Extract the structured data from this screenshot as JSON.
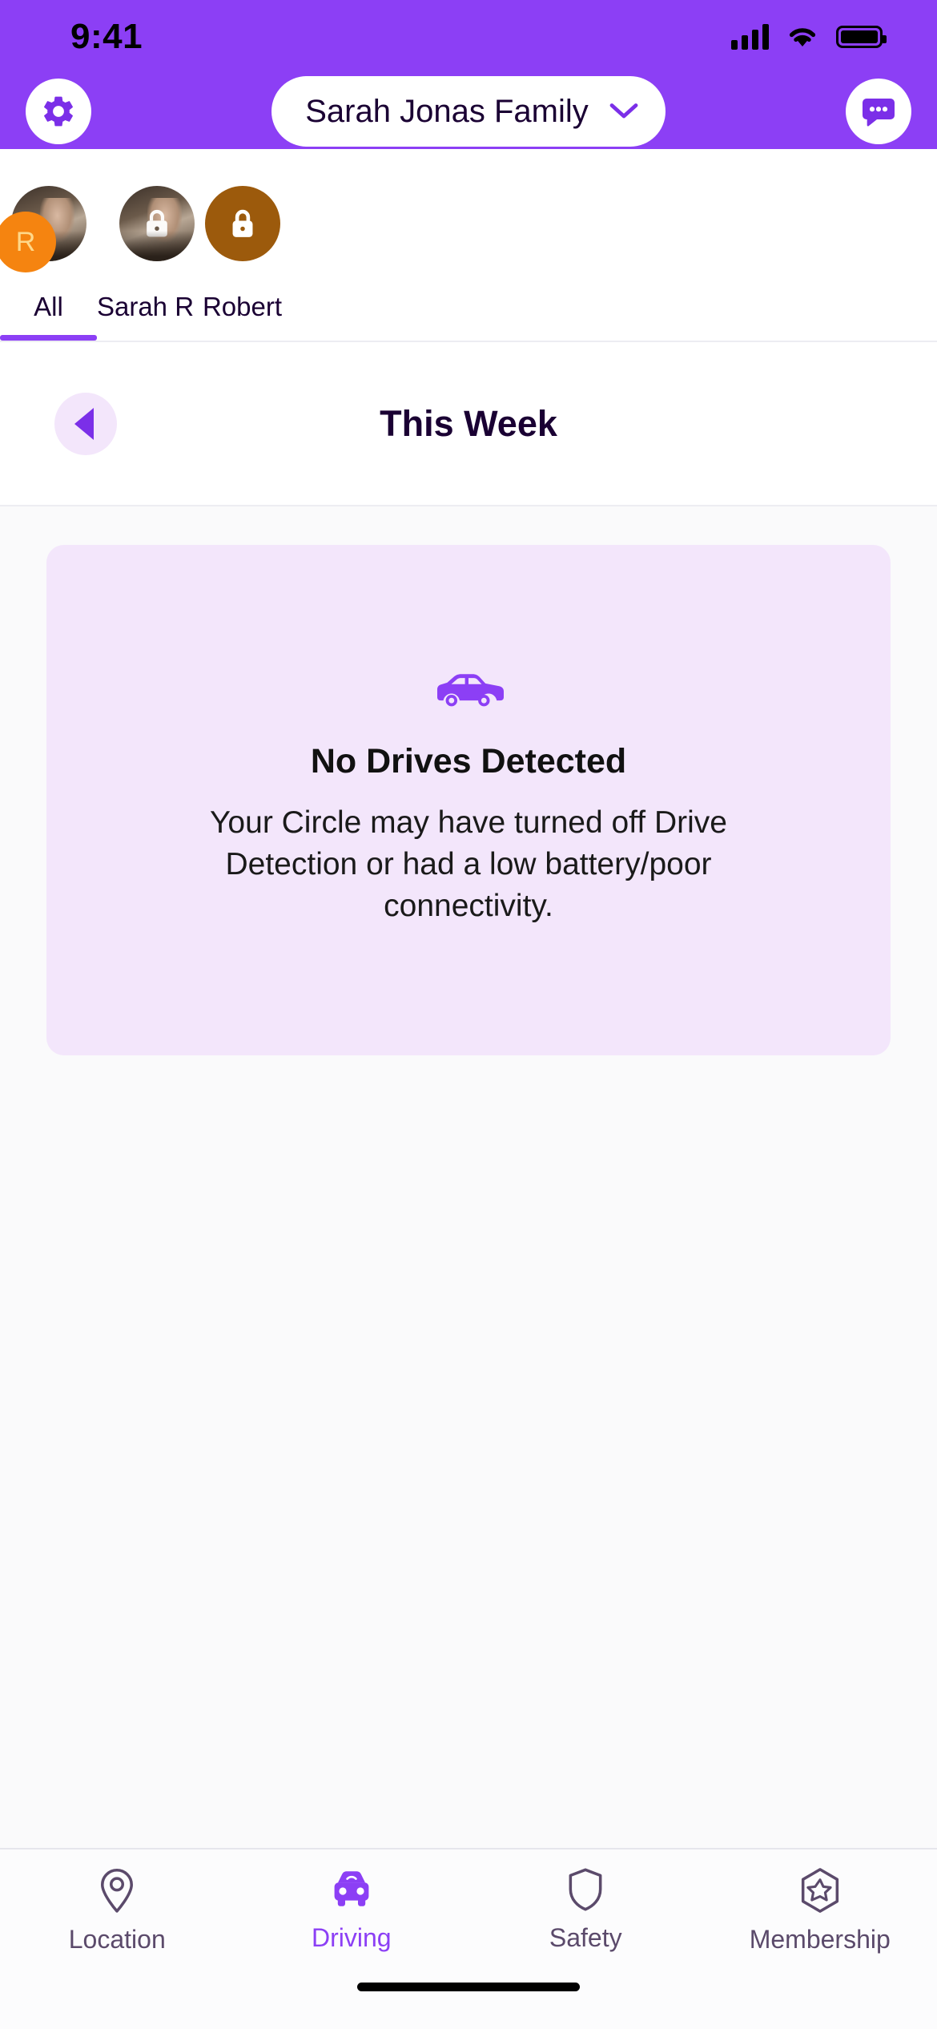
{
  "status_bar": {
    "time": "9:41",
    "signal_icon": "cellular-bars-icon",
    "wifi_icon": "wifi-icon",
    "battery_icon": "battery-full-icon"
  },
  "header": {
    "background_color": "#8C3FF5",
    "settings_icon": "gear-icon",
    "circle_name": "Sarah Jonas Family",
    "chevron_icon": "chevron-down-icon",
    "messages_icon": "chat-bubble-icon"
  },
  "member_tabs": {
    "active_index": 0,
    "items": [
      {
        "label": "All",
        "avatar_type": "stacked-photos",
        "badge_letter": "R",
        "badge_color": "#F58410",
        "active": true
      },
      {
        "label": "Sarah R",
        "avatar_type": "photo",
        "overlay_icon": "lock-icon",
        "active": false
      },
      {
        "label": "Robert",
        "avatar_type": "initial-circle",
        "avatar_color": "#9C5A0C",
        "overlay_icon": "lock-icon",
        "active": false
      }
    ]
  },
  "week_nav": {
    "back_icon": "triangle-left-icon",
    "title": "This Week"
  },
  "empty_state": {
    "card_color": "#F3E6FB",
    "icon": "car-side-icon",
    "icon_color": "#8C3FF5",
    "title": "No Drives Detected",
    "description": "Your Circle may have turned off Drive Detection or had a low battery/poor connectivity."
  },
  "tab_bar": {
    "active": "Driving",
    "active_color": "#8C3FF5",
    "inactive_color": "#5B4A6B",
    "items": [
      {
        "label": "Location",
        "icon": "map-pin-icon",
        "active": false
      },
      {
        "label": "Driving",
        "icon": "car-front-icon",
        "active": true
      },
      {
        "label": "Safety",
        "icon": "shield-icon",
        "active": false
      },
      {
        "label": "Membership",
        "icon": "hexagon-star-icon",
        "active": false
      }
    ]
  },
  "home_indicator": {
    "present": true
  }
}
